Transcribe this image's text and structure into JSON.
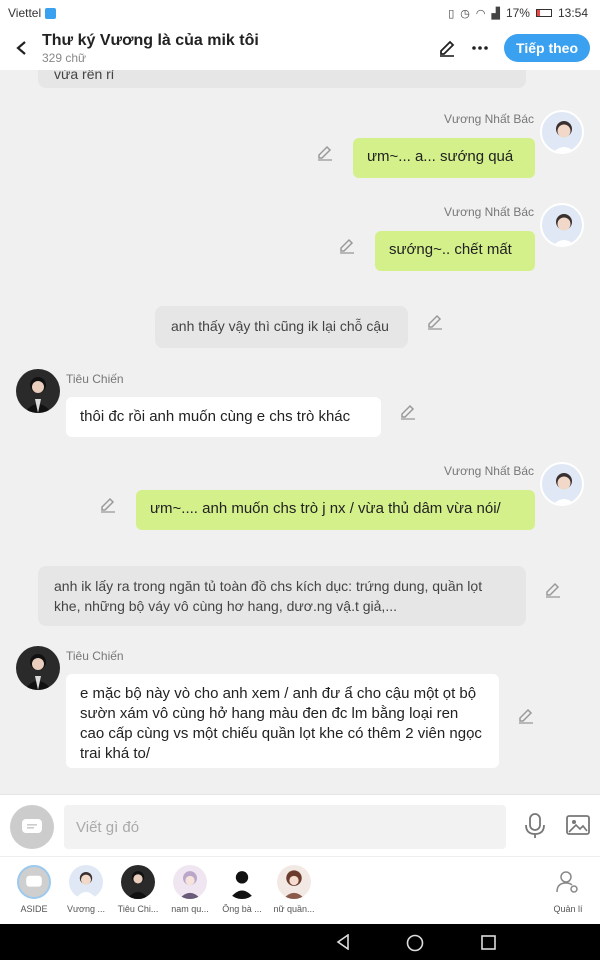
{
  "status_bar": {
    "carrier": "Viettel",
    "battery": "17%",
    "time": "13:54"
  },
  "header": {
    "title": "Thư ký Vương là của mik tôi",
    "word_count": "329 chữ",
    "next_label": "Tiếp theo"
  },
  "messages": [
    {
      "type": "narration",
      "text": "vừa rên rỉ"
    },
    {
      "type": "right",
      "name": "Vương Nhất Bác",
      "text": "ưm~... a... sướng quá"
    },
    {
      "type": "right",
      "name": "Vương Nhất Bác",
      "text": "sướng~.. chết mất"
    },
    {
      "type": "narration",
      "text": "anh thấy vậy thì cũng ik lại chỗ cậu"
    },
    {
      "type": "left",
      "name": "Tiêu Chiến",
      "text": "thôi đc rồi anh muốn cùng e chs trò khác"
    },
    {
      "type": "right",
      "name": "Vương Nhất Bác",
      "text": "ưm~.... anh muốn chs trò j nx / vừa thủ dâm vừa nói/"
    },
    {
      "type": "narration",
      "text": "anh ik lấy ra trong ngăn tủ toàn đồ chs kích dục: trứng dung,  quần lọt khe, những bộ váy vô cùng hơ hang, dươ.ng vậ.t giả,..."
    },
    {
      "type": "left",
      "name": "Tiêu Chiến",
      "text": "e mặc bộ này vò cho anh xem / anh đư ẩ cho cậu một ọt bộ sườn xám vô cùng hở hang màu đen đc lm bằng loại ren cao cấp cùng vs một chiếu quần lọt khe có thêm 2 viên ngọc trai khá to/"
    }
  ],
  "input": {
    "placeholder": "Viết gì đó"
  },
  "characters": [
    {
      "label": "ASIDE"
    },
    {
      "label": "Vương ..."
    },
    {
      "label": "Tiêu Chi..."
    },
    {
      "label": "nam qu..."
    },
    {
      "label": "Ông bà ..."
    },
    {
      "label": "nữ quần..."
    },
    {
      "label": "Quản lí"
    }
  ]
}
